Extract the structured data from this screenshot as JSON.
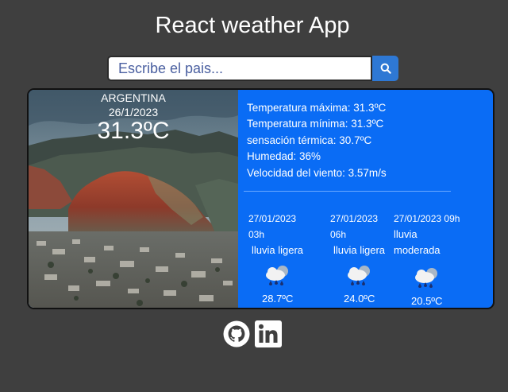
{
  "app": {
    "title": "React weather App"
  },
  "search": {
    "placeholder": "Escribe el pais..."
  },
  "current": {
    "country": "ARGENTINA",
    "date": "26/1/2023",
    "temperature": "31.3ºC",
    "details": [
      "Temperatura máxima: 31.3ºC",
      "Temperatura mínima: 31.3ºC",
      "sensación térmica: 30.7ºC",
      "Humedad: 36%",
      "Velocidad del viento: 3.57m/s"
    ]
  },
  "forecast": [
    {
      "date_line1": "27/01/2023",
      "date_line2": "03h",
      "desc_line1": "lluvia ligera",
      "desc_line2": "",
      "icon": "rain-cloud-icon",
      "temp": "28.7ºC"
    },
    {
      "date_line1": "27/01/2023",
      "date_line2": "06h",
      "desc_line1": "lluvia ligera",
      "desc_line2": "",
      "icon": "rain-cloud-icon",
      "temp": "24.0ºC"
    },
    {
      "date_line1": "27/01/2023 09h",
      "date_line2": "",
      "desc_line1": "lluvia",
      "desc_line2": "moderada",
      "icon": "rain-cloud-icon",
      "temp": "20.5ºC"
    }
  ],
  "footer": {
    "icons": [
      "github-icon",
      "linkedin-icon"
    ]
  },
  "colors": {
    "background": "#3f3f3f",
    "card": "#0a6cf5",
    "search_button": "#2e78d4"
  }
}
